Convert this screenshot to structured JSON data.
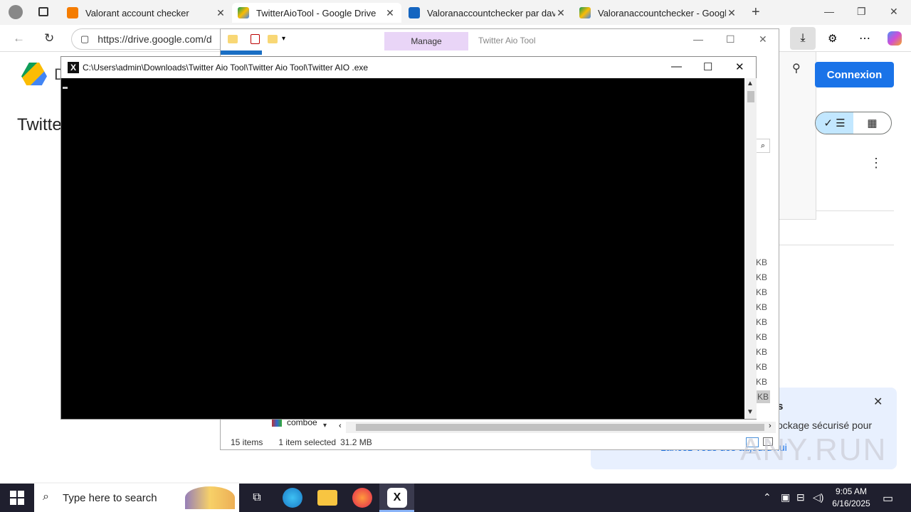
{
  "browser": {
    "tabs": [
      {
        "label": "Valorant account checker",
        "color": "#f57c00"
      },
      {
        "label": "TwitterAioTool - Google Drive",
        "color": "#1a73e8"
      },
      {
        "label": "Valoranaccountchecker par david",
        "color": "#1565c0"
      },
      {
        "label": "Valoranaccountchecker - Google",
        "color": "#1a73e8"
      }
    ],
    "tab_close": "✕",
    "new_tab": "+",
    "url": "https://drive.google.com/d"
  },
  "drive": {
    "title": "Twitte",
    "connexion": "Connexion",
    "view_list": "✓ ☰",
    "view_grid": "▦",
    "more": "⋮",
    "help": "?"
  },
  "toast": {
    "text": "ockage sécurisé pour",
    "partial": "s",
    "link": "Lancez-vous  des aujourd'hui"
  },
  "explorer": {
    "manage": "Manage",
    "name": "Twitter Aio Tool",
    "size_unit": "KB",
    "partial_file": "comboe",
    "status_count": "15 items",
    "status_selected": "1 item selected",
    "status_size": "31.2 MB"
  },
  "console": {
    "title": "C:\\Users\\admin\\Downloads\\Twitter Aio Tool\\Twitter Aio Tool\\Twitter AIO .exe",
    "icon": "X"
  },
  "taskbar": {
    "search_placeholder": "Type here to search",
    "time": "9:05 AM",
    "date": "6/16/2025"
  },
  "watermark": "ANY.RUN"
}
